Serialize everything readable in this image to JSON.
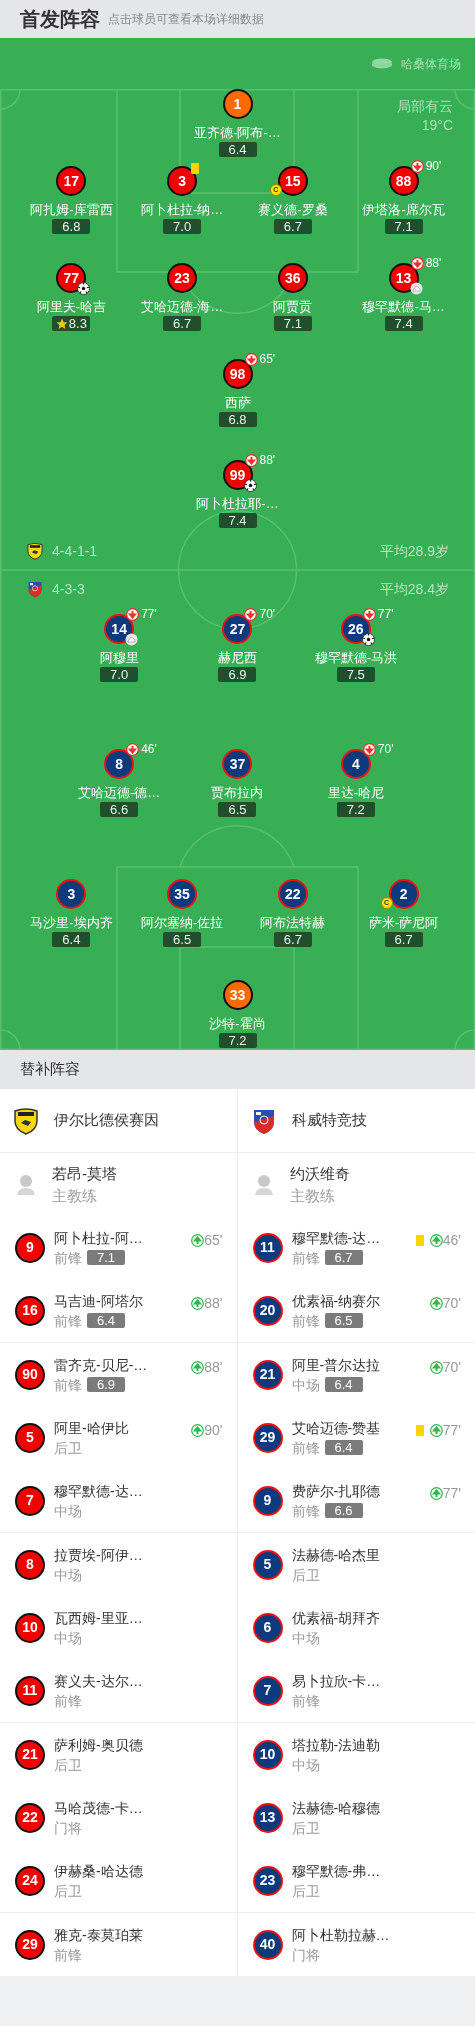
{
  "header": {
    "title": "首发阵容",
    "hint": "点击球员可查看本场详细数据"
  },
  "pitch": {
    "venue": "哈桑体育场",
    "weather": "局部有云",
    "temperature": "19°C",
    "home": {
      "formation": "4-4-1-1",
      "average_age": "平均28.9岁",
      "lines": [
        {
          "players": [
            {
              "number": "1",
              "name": "亚齐德-阿布-…",
              "rating": "6.4",
              "kind": "goalkeeper"
            }
          ]
        },
        {
          "players": [
            {
              "number": "17",
              "name": "阿扎姆-库雷西",
              "rating": "6.8",
              "kind": "outfield"
            },
            {
              "number": "3",
              "name": "阿卜杜拉-纳…",
              "rating": "7.0",
              "kind": "outfield",
              "events": [
                {
                  "kind": "booking"
                }
              ]
            },
            {
              "number": "15",
              "name": "赛义德-罗桑",
              "rating": "6.7",
              "kind": "outfield",
              "events": [
                {
                  "kind": "captain",
                  "label": "C"
                }
              ]
            },
            {
              "number": "88",
              "name": "伊塔洛-席尔瓦",
              "rating": "7.1",
              "kind": "outfield",
              "events": [
                {
                  "kind": "sub_off",
                  "minute": "90'"
                }
              ]
            }
          ]
        },
        {
          "players": [
            {
              "number": "77",
              "name": "阿里夫-哈吉",
              "rating": "8.3",
              "kind": "outfield",
              "events": [
                {
                  "kind": "goal"
                },
                {
                  "kind": "star"
                }
              ]
            },
            {
              "number": "23",
              "name": "艾哈迈德-海…",
              "rating": "6.7",
              "kind": "outfield"
            },
            {
              "number": "36",
              "name": "阿贾贡",
              "rating": "7.1",
              "kind": "outfield"
            },
            {
              "number": "13",
              "name": "穆罕默德-马…",
              "rating": "7.4",
              "kind": "outfield",
              "events": [
                {
                  "kind": "sub_off",
                  "minute": "88'"
                },
                {
                  "kind": "assist"
                }
              ]
            }
          ]
        },
        {
          "players": [
            {
              "number": "98",
              "name": "西萨",
              "rating": "6.8",
              "kind": "outfield",
              "events": [
                {
                  "kind": "sub_off",
                  "minute": "65'"
                }
              ]
            }
          ]
        },
        {
          "players": [
            {
              "number": "99",
              "name": "阿卜杜拉耶-…",
              "rating": "7.4",
              "kind": "outfield",
              "events": [
                {
                  "kind": "sub_off",
                  "minute": "88'"
                },
                {
                  "kind": "goal"
                }
              ]
            }
          ]
        }
      ]
    },
    "away": {
      "formation": "4-3-3",
      "average_age": "平均28.4岁",
      "lines": [
        {
          "players": [
            {
              "number": "14",
              "name": "阿穆里",
              "rating": "7.0",
              "kind": "outfield",
              "events": [
                {
                  "kind": "sub_off",
                  "minute": "77'"
                },
                {
                  "kind": "assist"
                }
              ]
            },
            {
              "number": "27",
              "name": "赫尼西",
              "rating": "6.9",
              "kind": "outfield",
              "events": [
                {
                  "kind": "sub_off",
                  "minute": "70'"
                }
              ]
            },
            {
              "number": "26",
              "name": "穆罕默德-马洪",
              "rating": "7.5",
              "kind": "outfield",
              "events": [
                {
                  "kind": "sub_off",
                  "minute": "77'"
                },
                {
                  "kind": "goal"
                }
              ]
            }
          ]
        },
        {
          "players": [
            {
              "number": "8",
              "name": "艾哈迈德-德…",
              "rating": "6.6",
              "kind": "outfield",
              "events": [
                {
                  "kind": "sub_off",
                  "minute": "46'"
                }
              ]
            },
            {
              "number": "37",
              "name": "贾布拉内",
              "rating": "6.5",
              "kind": "outfield"
            },
            {
              "number": "4",
              "name": "里达-哈尼",
              "rating": "7.2",
              "kind": "outfield",
              "events": [
                {
                  "kind": "sub_off",
                  "minute": "70'"
                }
              ]
            }
          ]
        },
        {
          "players": [
            {
              "number": "3",
              "name": "马沙里-埃内齐",
              "rating": "6.4",
              "kind": "outfield"
            },
            {
              "number": "35",
              "name": "阿尔塞纳-佐拉",
              "rating": "6.5",
              "kind": "outfield"
            },
            {
              "number": "22",
              "name": "阿布法特赫",
              "rating": "6.7",
              "kind": "outfield"
            },
            {
              "number": "2",
              "name": "萨米-萨尼阿",
              "rating": "6.7",
              "kind": "outfield",
              "events": [
                {
                  "kind": "captain",
                  "label": "C"
                }
              ]
            }
          ]
        },
        {
          "players": [
            {
              "number": "33",
              "name": "沙特-霍尚",
              "rating": "7.2",
              "kind": "goalkeeper"
            }
          ]
        }
      ]
    }
  },
  "bench": {
    "title": "替补阵容",
    "teams": [
      {
        "name": "伊尔比德侯赛因",
        "coach": {
          "name": "若昂-莫塔",
          "role": "主教练"
        },
        "players": [
          {
            "number": "9",
            "name": "阿卜杜拉-阿…",
            "position": "前锋",
            "rating": "7.1",
            "events": [
              {
                "kind": "sub_on",
                "minute": "65'"
              }
            ]
          },
          {
            "number": "16",
            "name": "马吉迪-阿塔尔",
            "position": "前锋",
            "rating": "6.4",
            "events": [
              {
                "kind": "sub_on",
                "minute": "88'"
              }
            ]
          },
          {
            "number": "90",
            "name": "雷齐克-贝尼-…",
            "position": "前锋",
            "rating": "6.9",
            "events": [
              {
                "kind": "sub_on",
                "minute": "88'"
              }
            ]
          },
          {
            "number": "5",
            "name": "阿里-哈伊比",
            "position": "后卫",
            "events": [
              {
                "kind": "sub_on",
                "minute": "90'"
              }
            ]
          },
          {
            "number": "7",
            "name": "穆罕默德-达…",
            "position": "中场"
          },
          {
            "number": "8",
            "name": "拉贾埃-阿伊…",
            "position": "中场"
          },
          {
            "number": "10",
            "name": "瓦西姆-里亚…",
            "position": "中场"
          },
          {
            "number": "11",
            "name": "赛义夫-达尔…",
            "position": "前锋"
          },
          {
            "number": "21",
            "name": "萨利姆-奥贝德",
            "position": "后卫"
          },
          {
            "number": "22",
            "name": "马哈茂德-卡…",
            "position": "门将"
          },
          {
            "number": "24",
            "name": "伊赫桑-哈达德",
            "position": "后卫"
          },
          {
            "number": "29",
            "name": "雅克-泰莫珀莱",
            "position": "前锋"
          }
        ]
      },
      {
        "name": "科威特竞技",
        "coach": {
          "name": "约沃维奇",
          "role": "主教练"
        },
        "players": [
          {
            "number": "11",
            "name": "穆罕默德-达…",
            "position": "前锋",
            "rating": "6.7",
            "events": [
              {
                "kind": "booking"
              },
              {
                "kind": "sub_on",
                "minute": "46'"
              }
            ]
          },
          {
            "number": "20",
            "name": "优素福-纳赛尔",
            "position": "前锋",
            "rating": "6.5",
            "events": [
              {
                "kind": "sub_on",
                "minute": "70'"
              }
            ]
          },
          {
            "number": "21",
            "name": "阿里-普尔达拉",
            "position": "中场",
            "rating": "6.4",
            "events": [
              {
                "kind": "sub_on",
                "minute": "70'"
              }
            ]
          },
          {
            "number": "29",
            "name": "艾哈迈德-赞基",
            "position": "前锋",
            "rating": "6.4",
            "events": [
              {
                "kind": "booking"
              },
              {
                "kind": "sub_on",
                "minute": "77'"
              }
            ]
          },
          {
            "number": "9",
            "name": "费萨尔-扎耶德",
            "position": "前锋",
            "rating": "6.6",
            "events": [
              {
                "kind": "sub_on",
                "minute": "77'"
              }
            ]
          },
          {
            "number": "5",
            "name": "法赫德-哈杰里",
            "position": "后卫"
          },
          {
            "number": "6",
            "name": "优素福-胡拜齐",
            "position": "中场"
          },
          {
            "number": "7",
            "name": "易卜拉欣-卡…",
            "position": "前锋"
          },
          {
            "number": "10",
            "name": "塔拉勒-法迪勒",
            "position": "中场"
          },
          {
            "number": "13",
            "name": "法赫德-哈穆德",
            "position": "后卫"
          },
          {
            "number": "23",
            "name": "穆罕默德-弗…",
            "position": "后卫"
          },
          {
            "number": "40",
            "name": "阿卜杜勒拉赫…",
            "position": "门将"
          }
        ]
      }
    ]
  }
}
